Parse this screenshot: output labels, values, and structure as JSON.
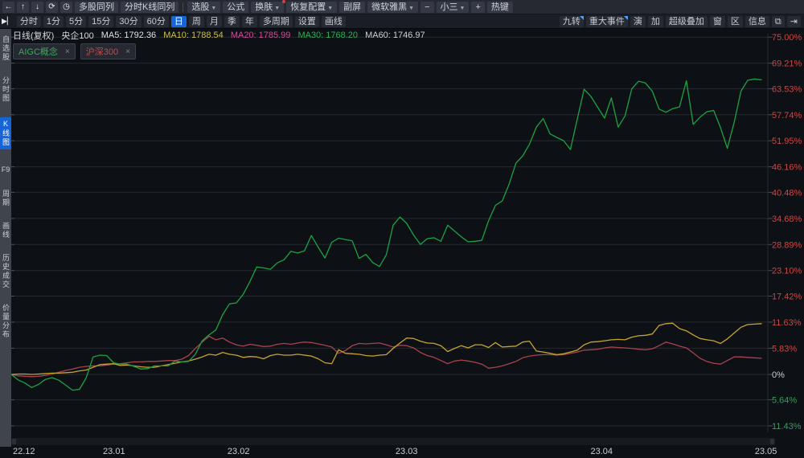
{
  "colors": {
    "axis_up": "#cb4747",
    "axis_down": "#33a157",
    "axis_zero": "#ccd0d6",
    "grid": "#262a30",
    "tick": "#4a505a"
  },
  "toolbar1": {
    "icon_buttons": [
      {
        "id": "back",
        "name": "back-arrow-icon",
        "glyph": "←"
      },
      {
        "id": "up",
        "name": "up-arrow-icon",
        "glyph": "↑"
      },
      {
        "id": "down",
        "name": "down-arrow-icon",
        "glyph": "↓"
      },
      {
        "id": "refresh",
        "name": "refresh-icon",
        "glyph": "⟳"
      },
      {
        "id": "history",
        "name": "clock-icon",
        "glyph": "◷"
      }
    ],
    "buttons": [
      {
        "id": "multi-stock-tile",
        "label": "多股同列"
      },
      {
        "id": "intraday-kline-tile",
        "label": "分时K线同列",
        "sep_after": true
      },
      {
        "id": "stock-picker",
        "label": "选股",
        "dropdown": true
      },
      {
        "id": "formula",
        "label": "公式"
      },
      {
        "id": "skin",
        "label": "换肤",
        "dropdown": true,
        "badge": true
      },
      {
        "id": "restore-config",
        "label": "恢复配置",
        "dropdown": true
      },
      {
        "id": "secondary-screen",
        "label": "副屏"
      },
      {
        "id": "font-family",
        "label": "微软雅黑",
        "dropdown": true
      },
      {
        "id": "font-smaller",
        "label": "−"
      },
      {
        "id": "font-size",
        "label": "小三",
        "dropdown": true
      },
      {
        "id": "font-larger",
        "label": "+"
      },
      {
        "id": "hotkeys",
        "label": "热键"
      }
    ]
  },
  "toolbar2": {
    "play_icon": "▶▏",
    "periods": [
      {
        "id": "intraday",
        "label": "分时"
      },
      {
        "id": "m1",
        "label": "1分"
      },
      {
        "id": "m5",
        "label": "5分"
      },
      {
        "id": "m15",
        "label": "15分"
      },
      {
        "id": "m30",
        "label": "30分"
      },
      {
        "id": "m60",
        "label": "60分"
      },
      {
        "id": "daily",
        "label": "日",
        "active": true
      },
      {
        "id": "weekly",
        "label": "周"
      },
      {
        "id": "monthly",
        "label": "月"
      },
      {
        "id": "quarterly",
        "label": "季"
      },
      {
        "id": "yearly",
        "label": "年"
      },
      {
        "id": "multi-period",
        "label": "多周期"
      },
      {
        "id": "settings",
        "label": "设置"
      },
      {
        "id": "draw-line",
        "label": "画线"
      }
    ],
    "tools": [
      {
        "id": "nine-turn",
        "label": "九转",
        "corner": true
      },
      {
        "id": "major-events",
        "label": "重大事件",
        "corner": true
      },
      {
        "id": "playback",
        "label": "演"
      },
      {
        "id": "add",
        "label": "加"
      },
      {
        "id": "super-overlay",
        "label": "超级叠加"
      },
      {
        "id": "window",
        "label": "窗"
      },
      {
        "id": "zone",
        "label": "区"
      },
      {
        "id": "info",
        "label": "信息"
      }
    ],
    "tool_icons": [
      {
        "id": "screens",
        "name": "dual-screens-icon",
        "glyph": "⧉"
      },
      {
        "id": "collapse",
        "name": "collapse-right-icon",
        "glyph": "⇥"
      }
    ]
  },
  "sidebar": {
    "items": [
      {
        "id": "watchlist",
        "label": "自选股"
      },
      {
        "id": "intraday-chart",
        "label": "分时图"
      },
      {
        "id": "kline-chart",
        "label": "K线图",
        "active": true
      },
      {
        "id": "f9",
        "label": "F9",
        "horizontal": true
      },
      {
        "id": "period",
        "label": "周期"
      },
      {
        "id": "draw-line",
        "label": "画线"
      },
      {
        "id": "history-trades",
        "label": "历史成交"
      },
      {
        "id": "price-volume",
        "label": "价量分布"
      }
    ]
  },
  "ma_row": {
    "spans": [
      {
        "id": "chart-type",
        "text": "日线(复权)",
        "color": "#d4d8de"
      },
      {
        "id": "instrument",
        "text": "央企100",
        "color": "#d4d8de"
      },
      {
        "id": "ma5",
        "text": "MA5: 1792.36",
        "color": "#dde0e6"
      },
      {
        "id": "ma10",
        "text": "MA10: 1788.54",
        "color": "#cdbf4b"
      },
      {
        "id": "ma20",
        "text": "MA20: 1785.99",
        "color": "#cc4f9b"
      },
      {
        "id": "ma30",
        "text": "MA30: 1768.20",
        "color": "#2fae57"
      },
      {
        "id": "ma60",
        "text": "MA60: 1746.97",
        "color": "#ccd0d8"
      }
    ]
  },
  "tags": [
    {
      "id": "aigc",
      "label": "AIGC概念",
      "color": "#3aa85c",
      "close": "×"
    },
    {
      "id": "hs300",
      "label": "沪深300",
      "color": "#c04c4c",
      "close": "×"
    }
  ],
  "chart_data": {
    "type": "line",
    "title": "日线(复权) 央企100 叠加对比",
    "grid": true,
    "legend_position": "top-left-tags",
    "y_axis": {
      "unit": "%",
      "range": [
        -11.43,
        75.0
      ],
      "ticks": [
        {
          "label": "75.00%",
          "v": 75.0
        },
        {
          "label": "69.21%",
          "v": 69.21
        },
        {
          "label": "63.53%",
          "v": 63.53
        },
        {
          "label": "57.74%",
          "v": 57.74
        },
        {
          "label": "51.95%",
          "v": 51.95
        },
        {
          "label": "46.16%",
          "v": 46.16
        },
        {
          "label": "40.48%",
          "v": 40.48
        },
        {
          "label": "34.68%",
          "v": 34.68
        },
        {
          "label": "28.89%",
          "v": 28.89
        },
        {
          "label": "23.10%",
          "v": 23.1
        },
        {
          "label": "17.42%",
          "v": 17.42
        },
        {
          "label": "11.63%",
          "v": 11.63
        },
        {
          "label": "5.83%",
          "v": 5.83
        },
        {
          "label": "0%",
          "v": 0
        },
        {
          "label": "5.64%",
          "v": -5.64
        },
        {
          "label": "11.43%",
          "v": -11.43
        }
      ]
    },
    "x_axis": {
      "ticks": [
        {
          "label": "22.12",
          "frac": 0.002,
          "anchor": "left"
        },
        {
          "label": "23.01",
          "frac": 0.137,
          "anchor": "center"
        },
        {
          "label": "23.02",
          "frac": 0.303,
          "anchor": "center"
        },
        {
          "label": "23.03",
          "frac": 0.527,
          "anchor": "center"
        },
        {
          "label": "23.04",
          "frac": 0.787,
          "anchor": "center"
        },
        {
          "label": "23.05",
          "frac": 1.006,
          "anchor": "center"
        }
      ]
    },
    "series": [
      {
        "name": "沪深300",
        "color": "#a8434e",
        "values": [
          0,
          -0.3,
          -0.4,
          -0.5,
          -0.4,
          -0.2,
          0.1,
          0.5,
          0.9,
          1.2,
          1.6,
          1.8,
          1.9,
          1.9,
          2.1,
          2.3,
          2.4,
          2.6,
          2.8,
          2.8,
          2.9,
          2.9,
          3.0,
          3.1,
          3.1,
          3.4,
          4.2,
          5.8,
          7.2,
          8.5,
          7.7,
          8.1,
          7.2,
          6.6,
          6.3,
          6.7,
          6.5,
          6.2,
          6.3,
          6.7,
          6.9,
          6.7,
          7.0,
          7.2,
          7.1,
          6.8,
          6.5,
          6.1,
          4.7,
          5.3,
          6.4,
          6.9,
          6.8,
          6.9,
          7.0,
          6.6,
          6.1,
          6.5,
          6.4,
          5.9,
          4.9,
          4.2,
          3.8,
          3.1,
          2.4,
          3.0,
          3.2,
          3.0,
          2.7,
          2.3,
          1.4,
          1.6,
          1.9,
          2.4,
          2.9,
          3.7,
          4.1,
          4.3,
          4.4,
          4.4,
          4.3,
          4.4,
          4.7,
          5.0,
          5.4,
          5.5,
          5.6,
          5.9,
          6.1,
          6.0,
          5.9,
          5.8,
          5.6,
          5.5,
          5.7,
          6.4,
          7.2,
          6.8,
          6.3,
          5.9,
          4.8,
          3.6,
          2.9,
          2.5,
          2.3,
          3.1,
          3.9,
          3.9,
          3.8,
          3.7,
          3.6
        ]
      },
      {
        "name": "央企100",
        "color": "#c7a430",
        "values": [
          0,
          0.1,
          0.1,
          0,
          0.1,
          0.2,
          0.3,
          0.3,
          0.4,
          0.5,
          0.8,
          1.0,
          1.6,
          2.2,
          2.3,
          2.4,
          2.0,
          2.1,
          1.9,
          1.7,
          1.6,
          1.6,
          1.9,
          2.2,
          2.5,
          2.8,
          3.0,
          3.4,
          3.9,
          4.5,
          4.3,
          4.9,
          4.5,
          4.3,
          3.8,
          4.0,
          3.9,
          3.5,
          4.2,
          4.5,
          4.3,
          4.3,
          4.5,
          4.3,
          4.1,
          3.5,
          2.6,
          2.4,
          5.5,
          4.7,
          4.6,
          4.5,
          4.2,
          4.1,
          4.3,
          4.4,
          5.8,
          7.0,
          8.1,
          8.0,
          7.4,
          7.0,
          6.9,
          6.4,
          5.1,
          5.8,
          6.4,
          5.9,
          6.6,
          6.6,
          6.0,
          7.1,
          6.1,
          6.2,
          6.3,
          7.2,
          7.4,
          5.2,
          5.0,
          4.7,
          4.4,
          4.6,
          5.0,
          5.4,
          6.6,
          7.2,
          7.3,
          7.5,
          7.7,
          7.8,
          7.7,
          8.3,
          8.6,
          8.7,
          9.0,
          10.9,
          11.3,
          11.4,
          10.2,
          9.7,
          8.8,
          8.0,
          7.7,
          7.5,
          6.9,
          7.9,
          9.2,
          10.5,
          11.1,
          11.2,
          11.3
        ]
      },
      {
        "name": "AIGC概念",
        "color": "#1ca244",
        "values": [
          0,
          -1.2,
          -1.9,
          -2.9,
          -2.2,
          -1.1,
          -0.7,
          -1.3,
          -2.4,
          -3.5,
          -3.3,
          -0.7,
          3.9,
          4.3,
          4.2,
          2.6,
          2.3,
          2.3,
          1.8,
          1.2,
          1.3,
          1.9,
          1.9,
          1.9,
          3.0,
          2.8,
          2.9,
          4.5,
          7.5,
          8.8,
          9.9,
          13.3,
          15.7,
          15.9,
          17.8,
          20.7,
          23.9,
          23.7,
          23.4,
          24.8,
          25.5,
          27.4,
          27.0,
          27.5,
          30.9,
          28.3,
          25.9,
          29.4,
          30.3,
          30.0,
          29.7,
          25.8,
          26.7,
          24.9,
          24.0,
          26.6,
          33.2,
          35.0,
          33.6,
          31.0,
          28.9,
          30.2,
          30.4,
          29.6,
          33.2,
          31.9,
          30.6,
          29.5,
          29.6,
          29.8,
          34.2,
          37.6,
          38.6,
          42.3,
          47.0,
          48.6,
          51.2,
          55.0,
          56.9,
          53.5,
          52.7,
          52.0,
          50.0,
          56.8,
          63.4,
          61.8,
          59.4,
          57.0,
          61.5,
          55.0,
          57.5,
          63.5,
          65.2,
          64.8,
          63.0,
          59.0,
          58.3,
          59.1,
          59.5,
          65.3,
          55.6,
          57.2,
          58.4,
          58.7,
          54.9,
          50.3,
          56.0,
          63.0,
          65.4,
          65.7,
          65.5
        ]
      }
    ]
  }
}
